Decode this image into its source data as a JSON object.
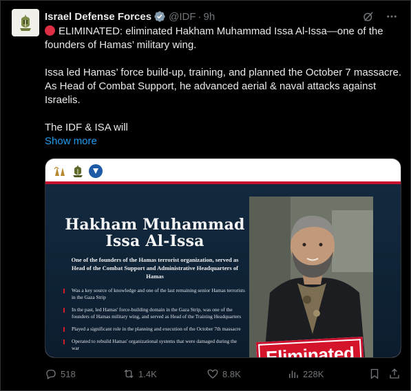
{
  "tweet": {
    "author_name": "Israel Defense Forces",
    "handle": "@IDF",
    "separator": "·",
    "time": "9h",
    "text_line1": "ELIMINATED: eliminated Hakham Muhammad Issa Al-Issa—one of the founders of Hamas’ military wing.",
    "text_line2": "Issa led Hamas’ force build-up, training, and planned the October 7 massacre. As Head of Combat Support, he advanced aerial & naval attacks against Israelis.",
    "text_line3": "The IDF & ISA will",
    "show_more": "Show more"
  },
  "media": {
    "title": "Hakham Muhammad Issa Al-Issa",
    "subtitle": "One of the founders of the Hamas terrorist organization, served as Head of the Combat Support and Administrative Headquarters of Hamas",
    "bullets": [
      "Was a key source of knowledge and one of the last remaining senior Hamas terrorists in the Gaza Strip",
      "In the past, led Hamas' force-building domain in the Gaza Strip, was one of the founders of Hamas military wing, and served as Head of the Training Headquarters",
      "Played a significant role in the planning and execution of the October 7th massacre",
      "Operated to rebuild Hamas' organizational systems that were damaged during the war"
    ],
    "stamp": "Eliminated"
  },
  "actions": {
    "replies": "518",
    "reposts": "1.4K",
    "likes": "8.8K",
    "views": "228K"
  },
  "colors": {
    "link": "#1d9bf0",
    "muted": "#71767b",
    "verified": "#829aab",
    "accent_red": "#c8102e"
  }
}
